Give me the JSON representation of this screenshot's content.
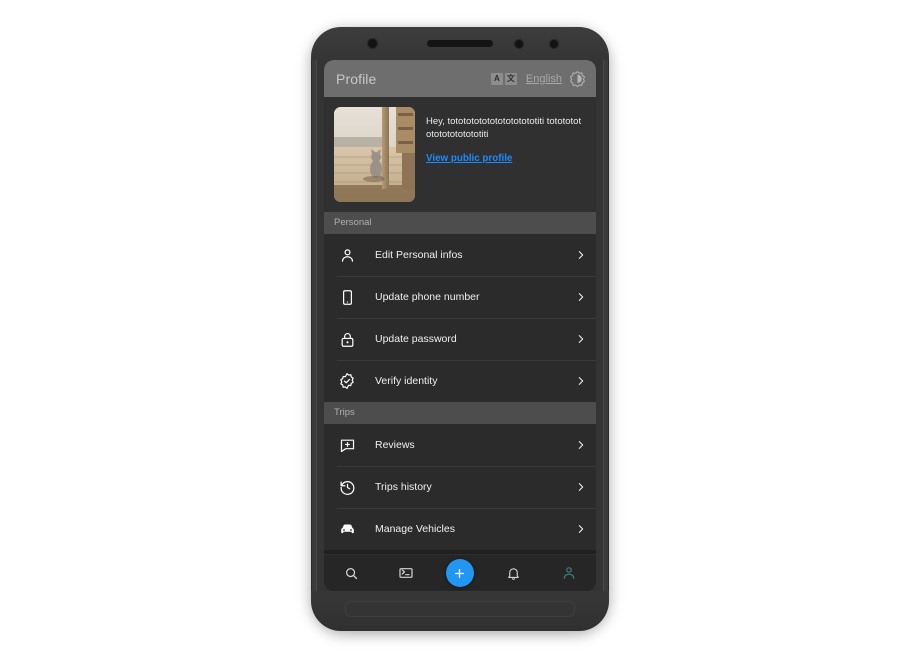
{
  "app": {
    "header": {
      "title": "Profile",
      "translate_icon": "translate-icon",
      "translate_letter_source": "A",
      "translate_letter_target": "文",
      "language": "English",
      "theme_toggle_icon": "brightness-contrast-icon"
    },
    "profile_card": {
      "avatar_alt": "cat-sitting-in-doorway-photo",
      "greeting": "Hey, totototototototototototiti totototototototototototiti",
      "public_profile_link": "View public profile"
    },
    "sections": [
      {
        "title": "Personal",
        "items": [
          {
            "label": "Edit Personal infos",
            "icon": "person-icon",
            "chevron": "chevron-right-icon"
          },
          {
            "label": "Update phone number",
            "icon": "phone-icon",
            "chevron": "chevron-right-icon"
          },
          {
            "label": "Update password",
            "icon": "lock-icon",
            "chevron": "chevron-right-icon"
          },
          {
            "label": "Verify identity",
            "icon": "verified-badge-icon",
            "chevron": "chevron-right-icon"
          }
        ]
      },
      {
        "title": "Trips",
        "items": [
          {
            "label": "Reviews",
            "icon": "review-comment-icon",
            "chevron": "chevron-right-icon"
          },
          {
            "label": "Trips history",
            "icon": "history-clock-icon",
            "chevron": "chevron-right-icon"
          },
          {
            "label": "Manage Vehicles",
            "icon": "car-icon",
            "chevron": "chevron-right-icon"
          }
        ]
      }
    ],
    "bottom_nav": {
      "items": [
        {
          "name": "search",
          "icon": "search-icon",
          "active": false
        },
        {
          "name": "messages",
          "icon": "message-ticket-icon",
          "active": false
        },
        {
          "name": "create",
          "icon": "plus-icon",
          "active": false
        },
        {
          "name": "notifications",
          "icon": "bell-icon",
          "active": false
        },
        {
          "name": "profile",
          "icon": "person-icon",
          "active": true
        }
      ]
    },
    "colors": {
      "appbar_bg": "#6e6e6e",
      "card_bg": "#303030",
      "section_band_bg": "#4d4d4d",
      "list_bg": "#2b2b2b",
      "link_blue": "#1a8cff",
      "fab_blue": "#2196f3",
      "active_nav_teal": "#3c7b7b"
    }
  }
}
